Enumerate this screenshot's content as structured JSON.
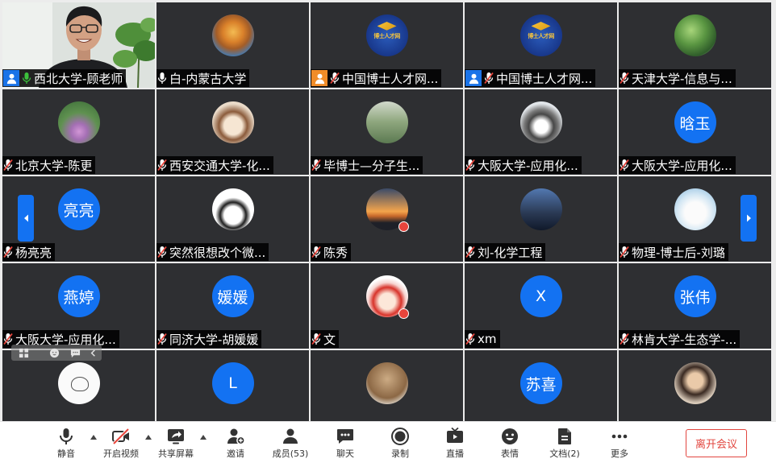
{
  "colors": {
    "accent": "#1372f2",
    "tile_background": "#2e2f32",
    "mic_active": "#3cc13b",
    "mic_muted_slash": "#e8453c",
    "leave_button": "#e2463f",
    "badge_blue": "#1a73e8",
    "badge_orange": "#f08c28"
  },
  "gallery": {
    "prev_page_icon": "chevron-left-icon",
    "next_page_icon": "chevron-right-icon",
    "tiles": [
      {
        "name": "西北大学-顾老师",
        "mic": "active",
        "badge": {
          "icon": "person-icon",
          "color": "#1a73e8"
        },
        "avatar": {
          "type": "video"
        }
      },
      {
        "name": "白-内蒙古大学",
        "mic": "on",
        "avatar": {
          "type": "image"
        }
      },
      {
        "name": "中国博士人才网...",
        "mic": "muted",
        "badge": {
          "icon": "person-icon",
          "color": "#f08c28"
        },
        "avatar": {
          "type": "image",
          "logo_text": "博士人才网"
        }
      },
      {
        "name": "中国博士人才网...",
        "mic": "muted",
        "badge": {
          "icon": "person-icon",
          "color": "#1a73e8"
        },
        "avatar": {
          "type": "image",
          "logo_text": "博士人才网"
        }
      },
      {
        "name": "天津大学-信息与...",
        "mic": "muted",
        "avatar": {
          "type": "image"
        }
      },
      {
        "name": "北京大学-陈更",
        "mic": "muted",
        "avatar": {
          "type": "image"
        }
      },
      {
        "name": "西安交通大学-化...",
        "mic": "muted",
        "avatar": {
          "type": "image"
        }
      },
      {
        "name": "毕博士—分子生...",
        "mic": "muted",
        "avatar": {
          "type": "image"
        }
      },
      {
        "name": "大阪大学-应用化...",
        "mic": "muted",
        "avatar": {
          "type": "image"
        }
      },
      {
        "name": "大阪大学-应用化...",
        "mic": "muted",
        "avatar": {
          "type": "text",
          "text": "晗玉"
        }
      },
      {
        "name": "杨亮亮",
        "mic": "muted",
        "avatar": {
          "type": "text",
          "text": "亮亮"
        }
      },
      {
        "name": "突然很想改个微...",
        "mic": "muted",
        "avatar": {
          "type": "image"
        }
      },
      {
        "name": "陈秀",
        "mic": "muted",
        "avatar": {
          "type": "image"
        }
      },
      {
        "name": "刘-化学工程",
        "mic": "muted",
        "avatar": {
          "type": "image"
        }
      },
      {
        "name": "物理-博士后-刘璐",
        "mic": "muted",
        "avatar": {
          "type": "image"
        }
      },
      {
        "name": "大阪大学-应用化...",
        "mic": "muted",
        "avatar": {
          "type": "text",
          "text": "燕婷"
        }
      },
      {
        "name": "同济大学-胡媛媛",
        "mic": "muted",
        "avatar": {
          "type": "text",
          "text": "媛媛"
        }
      },
      {
        "name": "文",
        "mic": "muted",
        "avatar": {
          "type": "image"
        }
      },
      {
        "name": "xm",
        "mic": "muted",
        "avatar": {
          "type": "text",
          "text": "X"
        }
      },
      {
        "name": "林肯大学-生态学-...",
        "mic": "muted",
        "avatar": {
          "type": "text",
          "text": "张伟"
        }
      },
      {
        "avatar": {
          "type": "image"
        }
      },
      {
        "avatar": {
          "type": "text",
          "text": "L"
        }
      },
      {
        "avatar": {
          "type": "image"
        }
      },
      {
        "avatar": {
          "type": "text",
          "text": "苏喜"
        }
      },
      {
        "avatar": {
          "type": "image"
        }
      }
    ]
  },
  "tile_overlay_toolbar": {
    "icons": [
      "grid-view-icon",
      "emoji-icon",
      "chat-icon",
      "chevron-left-icon"
    ]
  },
  "toolbar": {
    "items": [
      {
        "label": "静音",
        "icon": "microphone-icon"
      },
      {
        "label": "开启视频",
        "icon": "camera-off-icon"
      },
      {
        "label": "共享屏幕",
        "icon": "share-screen-icon"
      },
      {
        "label": "邀请",
        "icon": "invite-icon"
      },
      {
        "label": "成员(53)",
        "icon": "members-icon"
      },
      {
        "label": "聊天",
        "icon": "chat-icon"
      },
      {
        "label": "录制",
        "icon": "record-icon"
      },
      {
        "label": "直播",
        "icon": "live-icon"
      },
      {
        "label": "表情",
        "icon": "emoji-icon"
      },
      {
        "label": "文档(2)",
        "icon": "document-icon"
      },
      {
        "label": "更多",
        "icon": "more-icon"
      }
    ],
    "leave_label": "离开会议"
  }
}
